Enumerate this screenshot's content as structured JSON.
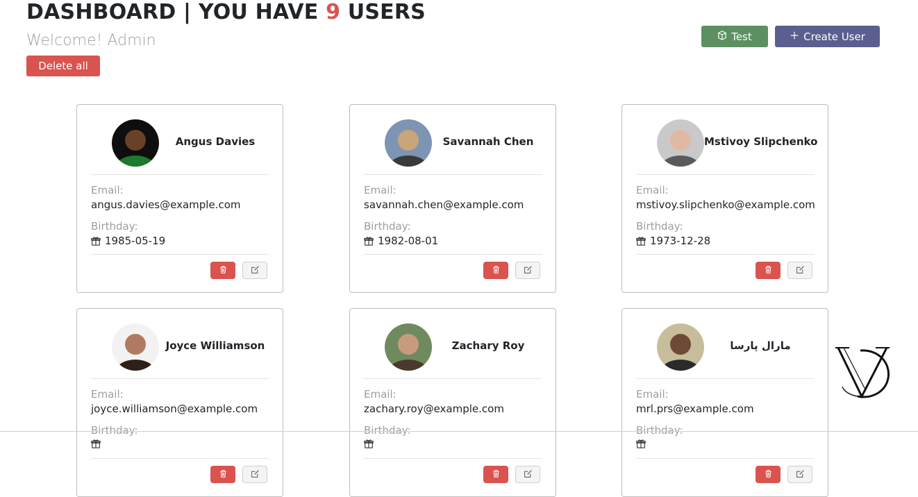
{
  "header": {
    "title_prefix": "DASHBOARD | YOU HAVE ",
    "user_count": "9",
    "title_suffix": " USERS",
    "welcome": "Welcome! Admin",
    "delete_all_label": "Delete all",
    "test_label": "Test",
    "create_user_label": "Create User"
  },
  "colors": {
    "danger": "#d9534f",
    "success": "#5c8f62",
    "primary": "#5a5f8f",
    "muted": "#9e9e9e"
  },
  "labels": {
    "email": "Email:",
    "birthday": "Birthday:"
  },
  "users": [
    {
      "name": "Angus Davies",
      "email": "angus.davies@example.com",
      "birthday": "1985-05-19",
      "avatar_icon": "avatar-photo"
    },
    {
      "name": "Savannah Chen",
      "email": "savannah.chen@example.com",
      "birthday": "1982-08-01",
      "avatar_icon": "avatar-photo"
    },
    {
      "name": "Mstivoy Slipchenko",
      "email": "mstivoy.slipchenko@example.com",
      "birthday": "1973-12-28",
      "avatar_icon": "avatar-photo"
    },
    {
      "name": "Joyce Williamson",
      "email": "joyce.williamson@example.com",
      "birthday": "",
      "avatar_icon": "avatar-photo"
    },
    {
      "name": "Zachary Roy",
      "email": "zachary.roy@example.com",
      "birthday": "",
      "avatar_icon": "avatar-photo"
    },
    {
      "name": "مارال پارسا",
      "email": "mrl.prs@example.com",
      "birthday": "",
      "avatar_icon": "avatar-photo"
    }
  ],
  "icons": {
    "test": "cube-icon",
    "create": "plus-icon",
    "birthday": "gift-icon",
    "delete": "trash-icon",
    "edit": "edit-icon"
  }
}
